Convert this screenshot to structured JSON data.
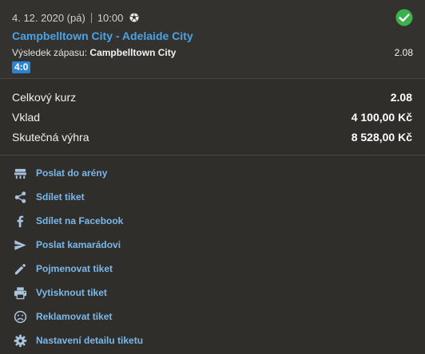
{
  "event": {
    "date": "4. 12. 2020 (pá)",
    "time": "10:00",
    "sport_icon": "soccer-ball-icon",
    "status_icon": "check-circle-icon",
    "status_color": "#3cb04b",
    "match": "Campbelltown City - Adelaide City",
    "market_label": "Výsledek zápasu:",
    "selection": "Campbelltown City",
    "odds": "2.08",
    "score": "4:0"
  },
  "totals": [
    {
      "label": "Celkový kurz",
      "value": "2.08"
    },
    {
      "label": "Vklad",
      "value": "4 100,00 Kč"
    },
    {
      "label": "Skutečná výhra",
      "value": "8 528,00 Kč"
    }
  ],
  "actions": [
    {
      "label": "Poslat do arény",
      "icon": "arena-icon"
    },
    {
      "label": "Sdílet tiket",
      "icon": "share-icon"
    },
    {
      "label": "Sdílet na Facebook",
      "icon": "facebook-icon"
    },
    {
      "label": "Poslat kamarádovi",
      "icon": "send-icon"
    },
    {
      "label": "Pojmenovat tiket",
      "icon": "pencil-icon"
    },
    {
      "label": "Vytisknout tiket",
      "icon": "print-icon"
    },
    {
      "label": "Reklamovat tiket",
      "icon": "sad-face-icon"
    },
    {
      "label": "Nastavení detailu tiketu",
      "icon": "gear-icon"
    }
  ],
  "colors": {
    "link": "#7ab8ea",
    "title": "#4aa3e6",
    "badge": "#2b83d6",
    "icon": "#a9c4dd"
  }
}
